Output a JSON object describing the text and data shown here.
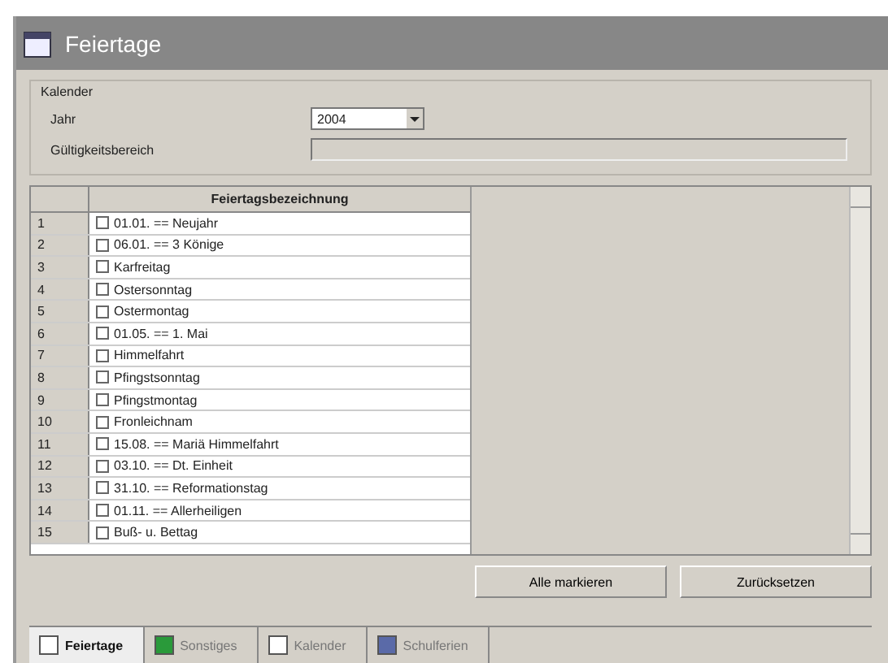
{
  "window": {
    "title": "Feiertage"
  },
  "group": {
    "title": "Kalender",
    "fields": [
      {
        "label": "Jahr",
        "kind": "dropdown",
        "value": "2004"
      },
      {
        "label": "Gültigkeitsbereich",
        "kind": "text"
      }
    ]
  },
  "table": {
    "columns": [
      "Feiertagsbezeichnung"
    ],
    "rows": [
      {
        "number": "1",
        "name": "01.01. == Neujahr",
        "checked": false
      },
      {
        "number": "2",
        "name": "06.01. == 3 Könige",
        "checked": false
      },
      {
        "number": "3",
        "name": "Karfreitag",
        "checked": false
      },
      {
        "number": "4",
        "name": "Ostersonntag",
        "checked": false
      },
      {
        "number": "5",
        "name": "Ostermontag",
        "checked": false
      },
      {
        "number": "6",
        "name": "01.05. == 1. Mai",
        "checked": false
      },
      {
        "number": "7",
        "name": "Himmelfahrt",
        "checked": false
      },
      {
        "number": "8",
        "name": "Pfingstsonntag",
        "checked": false
      },
      {
        "number": "9",
        "name": "Pfingstmontag",
        "checked": false
      },
      {
        "number": "10",
        "name": "Fronleichnam",
        "checked": false
      },
      {
        "number": "11",
        "name": "15.08. == Mariä Himmelfahrt",
        "checked": false
      },
      {
        "number": "12",
        "name": "03.10. == Dt. Einheit",
        "checked": false
      },
      {
        "number": "13",
        "name": "31.10. == Reformationstag",
        "checked": false
      },
      {
        "number": "14",
        "name": "01.11. == Allerheiligen",
        "checked": false
      },
      {
        "number": "15",
        "name": "Buß- u. Bettag",
        "checked": false
      }
    ]
  },
  "buttons": [
    "Alle markieren",
    "Zurücksetzen"
  ],
  "tabs": [
    {
      "label": "Feiertage",
      "selected": true
    },
    {
      "label": "Sonstiges",
      "selected": false
    },
    {
      "label": "Kalender",
      "selected": false
    },
    {
      "label": "Schulferien",
      "selected": false
    }
  ]
}
